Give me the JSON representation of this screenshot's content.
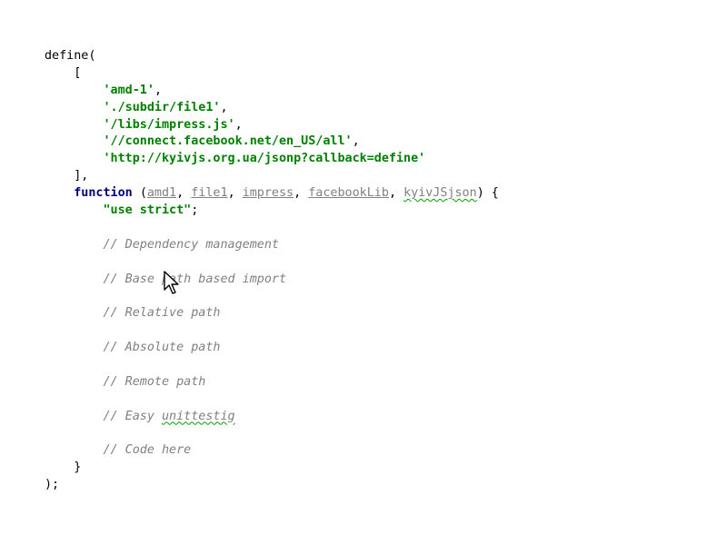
{
  "code": {
    "define_open": "define(",
    "array_open": "[",
    "deps": [
      "'amd-1'",
      "'./subdir/file1'",
      "'/libs/impress.js'",
      "'//connect.facebook.net/en_US/all'",
      "'http://kyivjs.org.ua/jsonp?callback=define'"
    ],
    "comma": ",",
    "array_close": "],",
    "function_kw": "function",
    "params": [
      "amd1",
      "file1",
      "impress",
      "facebookLib",
      "kyivJSjson"
    ],
    "paren_open": "(",
    "paren_close_brace": ") {",
    "use_strict": "\"use strict\"",
    "semicolon": ";",
    "comments": [
      "// Dependency management",
      "// Base path based import",
      "// Relative path",
      "// Absolute path",
      "// Remote path",
      "// Easy ",
      "// Code here"
    ],
    "typo_word": "unittestig",
    "brace_close": "}",
    "define_close": ");"
  }
}
